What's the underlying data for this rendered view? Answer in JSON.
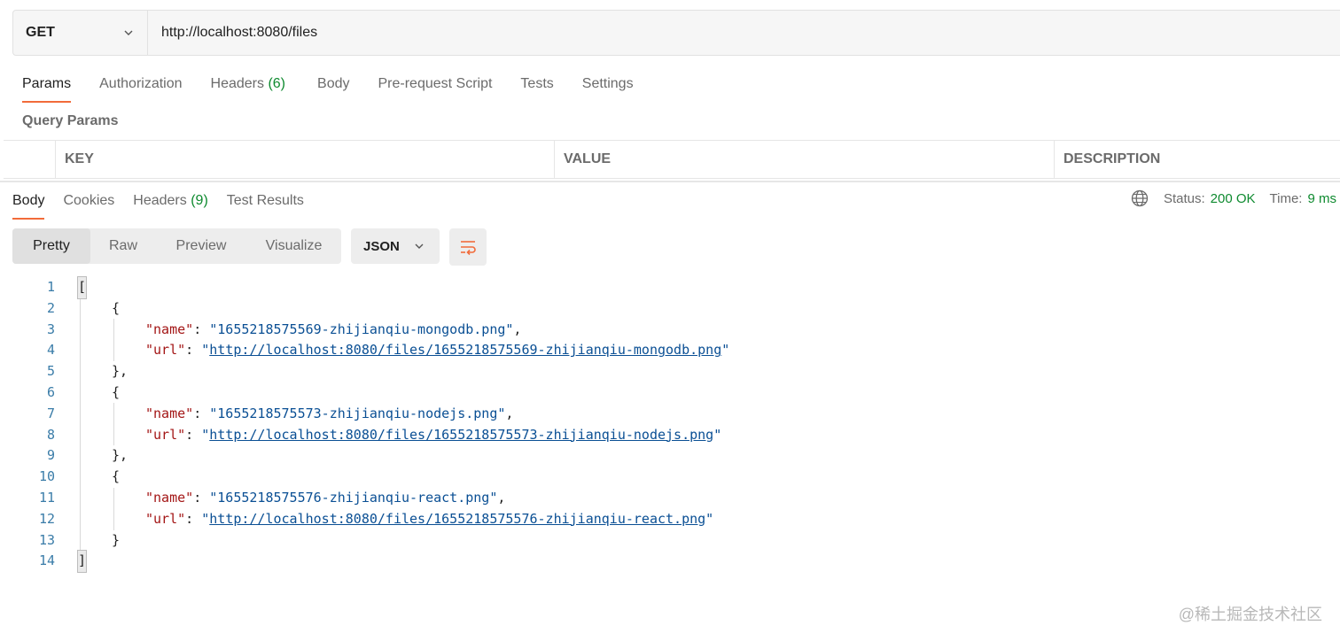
{
  "request": {
    "method": "GET",
    "url": "http://localhost:8080/files"
  },
  "request_tabs": [
    {
      "label": "Params",
      "count": ""
    },
    {
      "label": "Authorization",
      "count": ""
    },
    {
      "label": "Headers",
      "count": "(6)"
    },
    {
      "label": "Body",
      "count": ""
    },
    {
      "label": "Pre-request Script",
      "count": ""
    },
    {
      "label": "Tests",
      "count": ""
    },
    {
      "label": "Settings",
      "count": ""
    }
  ],
  "query_params": {
    "title": "Query Params",
    "columns": [
      "KEY",
      "VALUE",
      "DESCRIPTION"
    ]
  },
  "response_tabs": [
    {
      "label": "Body",
      "count": ""
    },
    {
      "label": "Cookies",
      "count": ""
    },
    {
      "label": "Headers",
      "count": "(9)"
    },
    {
      "label": "Test Results",
      "count": ""
    }
  ],
  "status": {
    "status_label": "Status:",
    "status_value": "200 OK",
    "time_label": "Time:",
    "time_value": "9 ms",
    "icon": "globe-icon"
  },
  "view_modes": [
    "Pretty",
    "Raw",
    "Preview",
    "Visualize"
  ],
  "format": "JSON",
  "wrap_icon": "wrap-lines-icon",
  "code_lines": [
    {
      "num": "1"
    },
    {
      "num": "2"
    },
    {
      "num": "3"
    },
    {
      "num": "4"
    },
    {
      "num": "5"
    },
    {
      "num": "6"
    },
    {
      "num": "7"
    },
    {
      "num": "8"
    },
    {
      "num": "9"
    },
    {
      "num": "10"
    },
    {
      "num": "11"
    },
    {
      "num": "12"
    },
    {
      "num": "13"
    },
    {
      "num": "14"
    }
  ],
  "json_tokens": {
    "open_array": "[",
    "close_array": "]",
    "open_obj": "{",
    "close_obj_comma": "},",
    "close_obj": "}",
    "key_name": "\"name\"",
    "key_url": "\"url\"",
    "colon": ": ",
    "comma": ",",
    "quote": "\""
  },
  "files": [
    {
      "name": "1655218575569-zhijianqiu-mongodb.png",
      "url": "http://localhost:8080/files/1655218575569-zhijianqiu-mongodb.png"
    },
    {
      "name": "1655218575573-zhijianqiu-nodejs.png",
      "url": "http://localhost:8080/files/1655218575573-zhijianqiu-nodejs.png"
    },
    {
      "name": "1655218575576-zhijianqiu-react.png",
      "url": "http://localhost:8080/files/1655218575576-zhijianqiu-react.png"
    }
  ],
  "watermark": "@稀土掘金技术社区",
  "colors": {
    "accent": "#f26b3a",
    "success": "#0e8a2f",
    "json_key": "#a31515",
    "json_string": "#0a4f94",
    "line_number": "#3a7ca8"
  }
}
